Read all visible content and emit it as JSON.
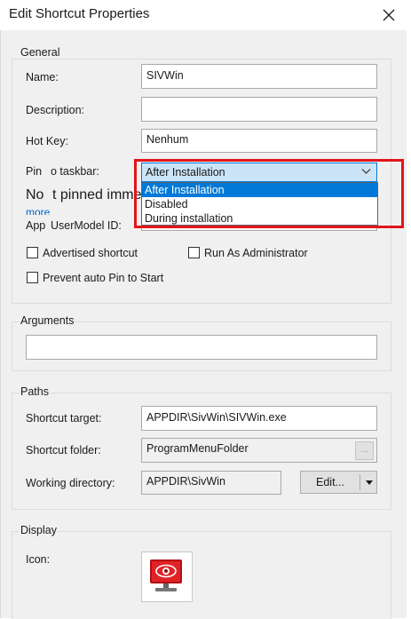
{
  "window": {
    "title": "Edit Shortcut Properties"
  },
  "general": {
    "group_title": "General",
    "name_label": "Name:",
    "name_value": "SIVWin",
    "description_label": "Description:",
    "description_value": "",
    "hotkey_label": "Hot Key:",
    "hotkey_value": "Nenhum",
    "pin_label": "Pin to taskbar:",
    "pin_label_left": "Pin",
    "pin_label_right": "o taskbar:",
    "pin_selected": "After Installation",
    "pin_options": [
      "After Installation",
      "Disabled",
      "During installation"
    ],
    "behind_text": "Not pinned immedi",
    "behind_text_left": "No",
    "behind_text_right": "t pinned immedi",
    "more_link": "more",
    "appusermodel_label": "AppUserModel ID:",
    "appusermodel_label_left": "App",
    "appusermodel_label_right": "UserModel ID:",
    "advertised_label": "Advertised shortcut",
    "advertised_checked": false,
    "run_as_admin_label": "Run As Administrator",
    "run_as_admin_checked": false,
    "prevent_pin_label": "Prevent auto Pin to Start",
    "prevent_pin_checked": false
  },
  "arguments": {
    "group_title": "Arguments",
    "value": ""
  },
  "paths": {
    "group_title": "Paths",
    "target_label": "Shortcut target:",
    "target_value": "APPDIR\\SivWin\\SIVWin.exe",
    "folder_label": "Shortcut folder:",
    "folder_value": "ProgramMenuFolder",
    "folder_browse": "...",
    "workdir_label": "Working directory:",
    "workdir_value": "APPDIR\\SivWin",
    "edit_button": "Edit..."
  },
  "display": {
    "group_title": "Display",
    "icon_label": "Icon:",
    "icon_name": "siv-app-icon"
  },
  "colors": {
    "highlight_box": "#e3151a",
    "selection": "#0078d7",
    "link": "#0066cc"
  }
}
